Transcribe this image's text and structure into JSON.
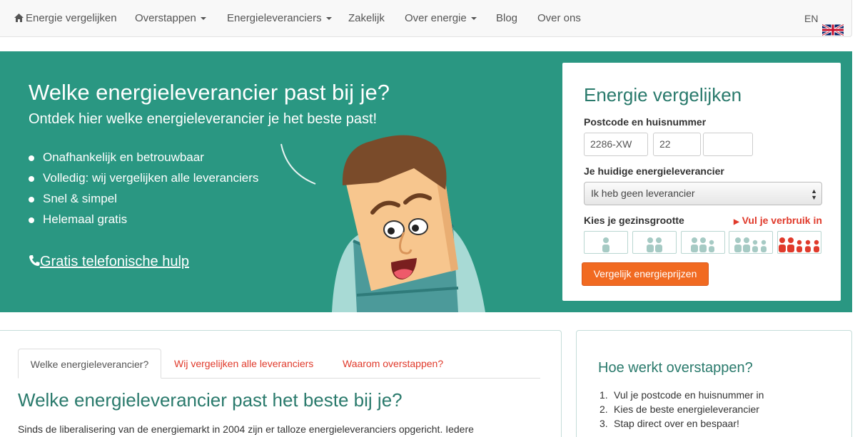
{
  "nav": {
    "home": "Energie vergelijken",
    "items": [
      "Overstappen",
      "Energieleveranciers",
      "Zakelijk",
      "Over energie",
      "Blog",
      "Over ons"
    ],
    "lang": "EN"
  },
  "hero": {
    "title": "Welke energieleverancier past bij je?",
    "subtitle": "Ontdek hier welke energieleverancier je het beste past!",
    "bullets": [
      "Onafhankelijk en betrouwbaar",
      "Volledig: wij vergelijken alle leveranciers",
      "Snel & simpel",
      "Helemaal gratis"
    ],
    "phone_link": "Gratis telefonische hulp"
  },
  "form": {
    "title": "Energie vergelijken",
    "postcode_label": "Postcode en huisnummer",
    "postcode_value": "2286-XW",
    "housenumber_value": "22",
    "addition_value": "",
    "supplier_label": "Je huidige energieleverancier",
    "supplier_selected": "Ik heb geen leverancier",
    "household_label": "Kies je gezinsgrootte",
    "usage_link": "Vul je verbruik in",
    "household_selected": 5,
    "household_options": [
      1,
      2,
      3,
      4,
      5
    ],
    "submit": "Vergelijk energieprijzen",
    "colors": {
      "accent": "#f16a21",
      "selected": "#e03a2b",
      "teal": "#2a9782"
    }
  },
  "tabs": [
    "Welke energieleverancier?",
    "Wij vergelijken alle leveranciers",
    "Waarom overstappen?"
  ],
  "content": {
    "title": "Welke energieleverancier past het beste bij je?",
    "paragraph": "Sinds de liberalisering van de energiemarkt in 2004 zijn er talloze energieleveranciers opgericht. Iedere"
  },
  "sidebar": {
    "title": "Hoe werkt overstappen?",
    "steps": [
      "Vul je postcode en huisnummer in",
      "Kies de beste energieleverancier",
      "Stap direct over en bespaar!"
    ]
  }
}
